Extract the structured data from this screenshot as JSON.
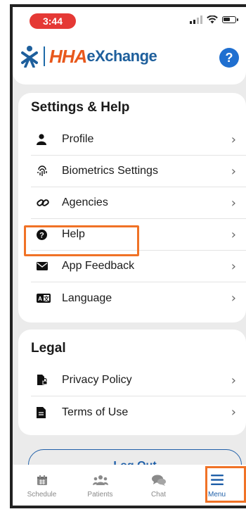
{
  "status_bar": {
    "time": "3:44",
    "icons": [
      "signal-icon",
      "wifi-icon",
      "battery-icon"
    ]
  },
  "header": {
    "logo_primary": "HHA",
    "logo_secondary": "eXchange",
    "help_button": "?"
  },
  "settings_section": {
    "title": "Settings & Help",
    "items": [
      {
        "label": "Profile",
        "icon": "person-icon"
      },
      {
        "label": "Biometrics Settings",
        "icon": "fingerprint-icon"
      },
      {
        "label": "Agencies",
        "icon": "link-icon"
      },
      {
        "label": "Help",
        "icon": "question-circle-icon"
      },
      {
        "label": "App Feedback",
        "icon": "envelope-icon"
      },
      {
        "label": "Language",
        "icon": "language-icon"
      }
    ]
  },
  "legal_section": {
    "title": "Legal",
    "items": [
      {
        "label": "Privacy Policy",
        "icon": "document-lock-icon"
      },
      {
        "label": "Terms of Use",
        "icon": "document-icon"
      }
    ]
  },
  "logout_button": "Log Out",
  "tab_bar": {
    "tabs": [
      {
        "label": "Schedule",
        "icon": "calendar-icon"
      },
      {
        "label": "Patients",
        "icon": "people-icon"
      },
      {
        "label": "Chat",
        "icon": "chat-icon"
      },
      {
        "label": "Menu",
        "icon": "hamburger-icon"
      }
    ],
    "active": "Menu"
  },
  "colors": {
    "status_pill": "#e53935",
    "logo_hha": "#e8581c",
    "logo_exchange": "#1e5f9c",
    "accent": "#1f6fd0",
    "highlight": "#f07226",
    "background": "#ebebeb"
  }
}
